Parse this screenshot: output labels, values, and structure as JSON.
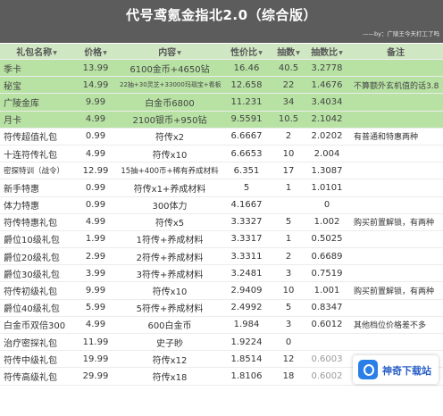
{
  "title": "代号鸢氪金指北2.0（综合版）",
  "credit": "——by：广陵王今天打工了吗",
  "headers": [
    "礼包名称",
    "价格",
    "内容",
    "性价比",
    "抽数",
    "抽数比",
    "备注"
  ],
  "rows": [
    {
      "name": "季卡",
      "price": "13.99",
      "content": "6100金币+4650钻",
      "ratio": "16.46",
      "pulls": "40.5",
      "pull_ratio": "3.2778",
      "note": ""
    },
    {
      "name": "秘宝",
      "price": "14.99",
      "content": "22抽+30灵芝+33000玛瑙宝+看板素",
      "ratio": "12.658",
      "pulls": "22",
      "pull_ratio": "1.4676",
      "note": "不算额外玄机值的话3.8"
    },
    {
      "name": "广陵金库",
      "price": "9.99",
      "content": "白金币6800",
      "ratio": "11.231",
      "pulls": "34",
      "pull_ratio": "3.4034",
      "note": ""
    },
    {
      "name": "月卡",
      "price": "4.99",
      "content": "2100银币+950钻",
      "ratio": "9.5591",
      "pulls": "10.5",
      "pull_ratio": "2.1042",
      "note": ""
    },
    {
      "name": "符传超值礼包",
      "price": "0.99",
      "content": "符传x2",
      "ratio": "6.6667",
      "pulls": "2",
      "pull_ratio": "2.0202",
      "note": "有普通和特惠两种"
    },
    {
      "name": "十连符传礼包",
      "price": "4.99",
      "content": "符传x10",
      "ratio": "6.6653",
      "pulls": "10",
      "pull_ratio": "2.004",
      "note": ""
    },
    {
      "name": "密探特训（战令）",
      "price": "12.99",
      "content": "15抽+400币+稀有养成材料",
      "ratio": "6.351",
      "pulls": "17",
      "pull_ratio": "1.3087",
      "note": ""
    },
    {
      "name": "新手特惠",
      "price": "0.99",
      "content": "符传x1+养成材料",
      "ratio": "5",
      "pulls": "1",
      "pull_ratio": "1.0101",
      "note": ""
    },
    {
      "name": "体力特惠",
      "price": "0.99",
      "content": "300体力",
      "ratio": "4.1667",
      "pulls": "",
      "pull_ratio": "0",
      "note": ""
    },
    {
      "name": "符传特惠礼包",
      "price": "4.99",
      "content": "符传x5",
      "ratio": "3.3327",
      "pulls": "5",
      "pull_ratio": "1.002",
      "note": "购买前置解锁，有两种"
    },
    {
      "name": "爵位10级礼包",
      "price": "1.99",
      "content": "1符传+养成材料",
      "ratio": "3.3317",
      "pulls": "1",
      "pull_ratio": "0.5025",
      "note": ""
    },
    {
      "name": "爵位20级礼包",
      "price": "2.99",
      "content": "2符传+养成材料",
      "ratio": "3.3311",
      "pulls": "2",
      "pull_ratio": "0.6689",
      "note": ""
    },
    {
      "name": "爵位30级礼包",
      "price": "3.99",
      "content": "3符传+养成材料",
      "ratio": "3.2481",
      "pulls": "3",
      "pull_ratio": "0.7519",
      "note": ""
    },
    {
      "name": "符传初级礼包",
      "price": "9.99",
      "content": "符传x10",
      "ratio": "2.9409",
      "pulls": "10",
      "pull_ratio": "1.001",
      "note": "购买前置解锁，有两种"
    },
    {
      "name": "爵位40级礼包",
      "price": "5.99",
      "content": "5符传+养成材料",
      "ratio": "2.4992",
      "pulls": "5",
      "pull_ratio": "0.8347",
      "note": ""
    },
    {
      "name": "白金币双倍300",
      "price": "4.99",
      "content": "600白金币",
      "ratio": "1.984",
      "pulls": "3",
      "pull_ratio": "0.6012",
      "note": "其他档位价格差不多"
    },
    {
      "name": "治疗密探礼包",
      "price": "11.99",
      "content": "史子眇",
      "ratio": "1.9224",
      "pulls": "0",
      "pull_ratio": "",
      "note": ""
    },
    {
      "name": "符传中级礼包",
      "price": "19.99",
      "content": "符传x12",
      "ratio": "1.8514",
      "pulls": "12",
      "pull_ratio": "0.6003",
      "note": ""
    },
    {
      "name": "符传高级礼包",
      "price": "29.99",
      "content": "符传x18",
      "ratio": "1.8106",
      "pulls": "18",
      "pull_ratio": "0.6002",
      "note": ""
    }
  ],
  "watermark": {
    "text": "神奇下载站",
    "icon": "download-site-logo-icon"
  },
  "colors": {
    "header_bg": "#5c5c5c",
    "column_header_bg": "#cfe8c3",
    "highlight_row_bg": "#b7e2a3",
    "watermark_blue": "#2a7ee8"
  }
}
